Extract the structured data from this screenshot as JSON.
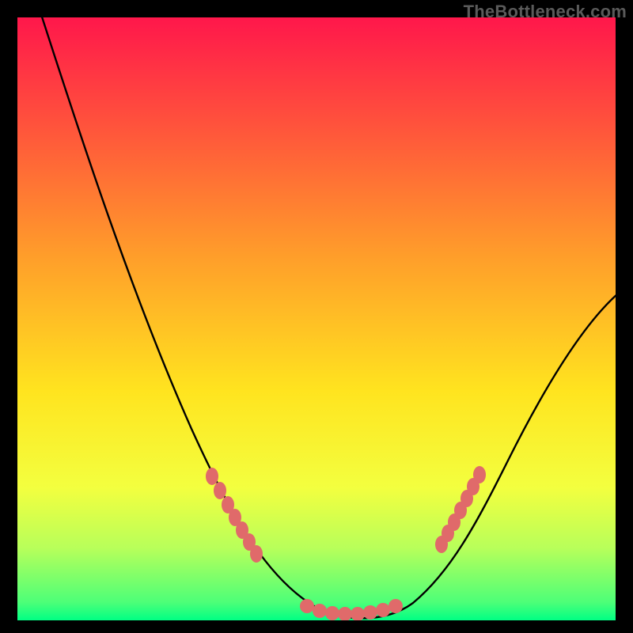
{
  "watermark": "TheBottleneck.com",
  "chart_data": {
    "type": "line",
    "title": "",
    "xlabel": "",
    "ylabel": "",
    "xlim": [
      0,
      100
    ],
    "ylim": [
      0,
      100
    ],
    "grid": false,
    "legend": false,
    "series": [
      {
        "name": "bottleneck-curve",
        "x": [
          2,
          6,
          10,
          14,
          18,
          22,
          26,
          30,
          34,
          38,
          42,
          46,
          50,
          54,
          58,
          62,
          66,
          70,
          74,
          78,
          82,
          86,
          90,
          94,
          98
        ],
        "y": [
          100,
          93,
          85,
          77,
          69,
          61,
          53,
          45,
          37,
          29,
          21,
          13,
          6,
          2,
          0,
          0,
          2,
          7,
          15,
          23,
          31,
          38,
          44,
          50,
          55
        ]
      }
    ],
    "markers": {
      "name": "highlight-dots",
      "color": "#e46a6a",
      "points_x": [
        31,
        33,
        35,
        36.5,
        38,
        39.5,
        48,
        50,
        52,
        54,
        56,
        58,
        60,
        62,
        66,
        67,
        68,
        69,
        70,
        71,
        72
      ],
      "points_y": [
        20,
        18,
        15.5,
        13.5,
        12,
        10.5,
        1.5,
        1.0,
        0.7,
        0.5,
        0.5,
        0.6,
        0.8,
        1.2,
        13,
        14.5,
        16,
        18,
        19.5,
        21,
        22.5
      ]
    },
    "gradient_stops": [
      {
        "pos": 0,
        "color": "#ff174b"
      },
      {
        "pos": 20,
        "color": "#ff5a3a"
      },
      {
        "pos": 40,
        "color": "#ff9f2a"
      },
      {
        "pos": 62,
        "color": "#ffe41f"
      },
      {
        "pos": 78,
        "color": "#f3ff3f"
      },
      {
        "pos": 88,
        "color": "#b8ff5a"
      },
      {
        "pos": 97,
        "color": "#4dff78"
      },
      {
        "pos": 100,
        "color": "#00ff84"
      }
    ]
  }
}
